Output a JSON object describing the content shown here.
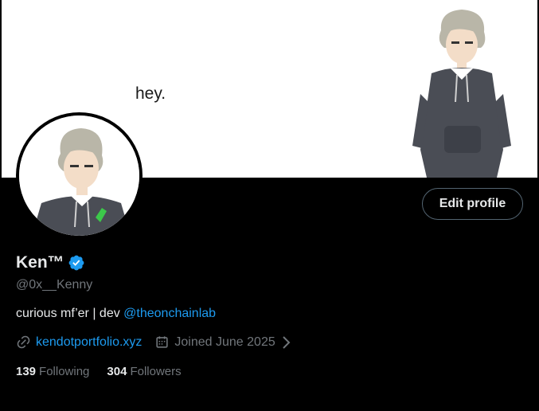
{
  "banner": {
    "text": "hey."
  },
  "profile": {
    "display_name": "Ken™",
    "handle": "@0x__Kenny",
    "bio_text": "curious mf’er | dev ",
    "bio_mention": "@theonchainlab",
    "website": "kendotportfolio.xyz",
    "joined": "Joined June 2025",
    "following_count": "139",
    "following_label": "Following",
    "followers_count": "304",
    "followers_label": "Followers",
    "edit_label": "Edit profile"
  },
  "colors": {
    "accent": "#1d9bf0",
    "muted": "#71767b",
    "text": "#e7e9ea",
    "background": "#000000",
    "verified": "#1d9bf0"
  },
  "icons": {
    "verified": "verified-badge-icon",
    "link": "link-icon",
    "calendar": "calendar-icon",
    "chevron": "chevron-right-icon"
  }
}
